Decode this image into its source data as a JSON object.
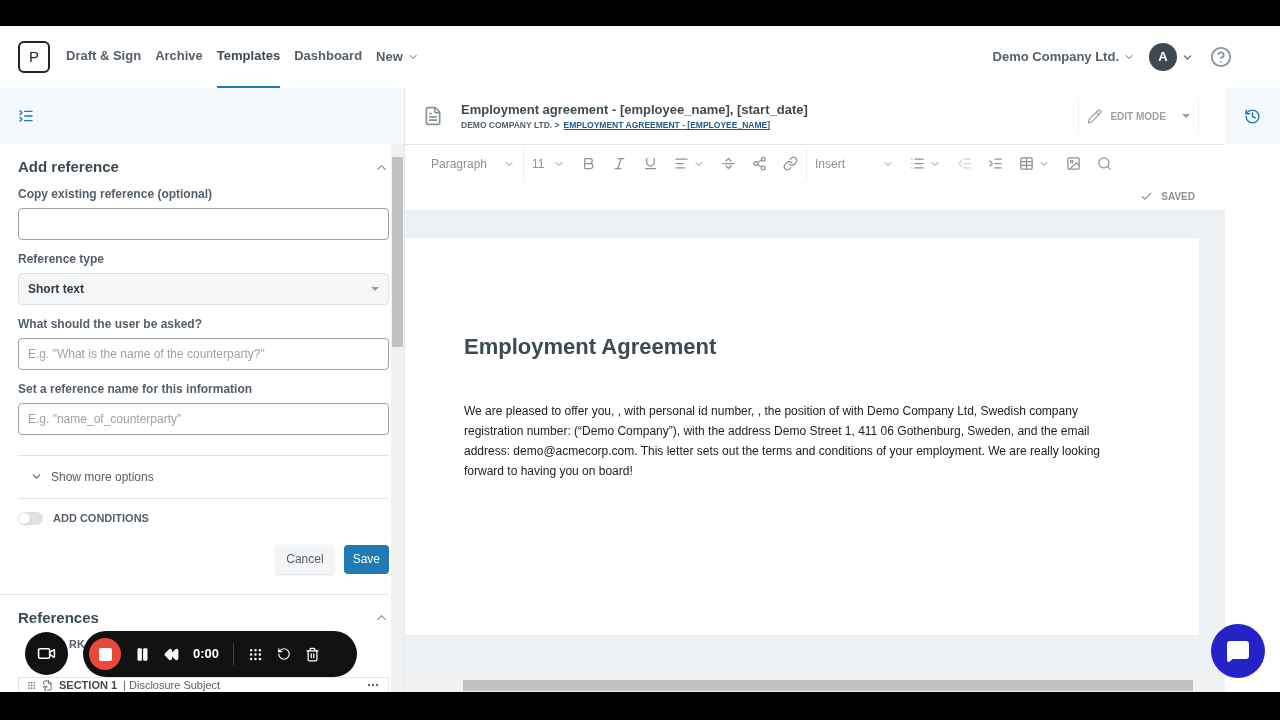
{
  "nav": {
    "logo": "P",
    "items": [
      {
        "label": "Draft & Sign",
        "selected": false
      },
      {
        "label": "Archive",
        "selected": false
      },
      {
        "label": "Templates",
        "selected": true
      },
      {
        "label": "Dashboard",
        "selected": false
      }
    ],
    "new_menu": "New",
    "company": "Demo Company Ltd.",
    "avatar": "A"
  },
  "panel": {
    "title": "Add reference",
    "fields": [
      {
        "kind": "input",
        "label": "Copy existing reference (optional)"
      },
      {
        "kind": "select",
        "label": "Reference type",
        "value": "Short text"
      },
      {
        "kind": "input",
        "label": "What should the user be asked?",
        "placeholder": "E.g. \"What is the name of the counterparty?\""
      },
      {
        "kind": "input",
        "label": "Set a reference name for this information",
        "placeholder": "E.g. \"name_of_counterparty\""
      }
    ],
    "more_options": "Show more options",
    "conditions": {
      "label": "ADD CONDITIONS",
      "on": false
    },
    "cancel": "Cancel",
    "save": "Save",
    "references": {
      "title": "References",
      "toggle_label": "RK",
      "section": {
        "number": "SECTION 1",
        "title": "| Disclosure Subject"
      }
    }
  },
  "document": {
    "title": "Employment agreement - [employee_name], [start_date]",
    "breadcrumb": "DEMO COMPANY LTD. >",
    "breadcrumb_link": "EMPLOYMENT AGREEMENT - [EMPLOYEE_NAME]",
    "mode": "EDIT MODE",
    "toolbar": {
      "style": "Paragraph",
      "size": "11",
      "insert": "Insert"
    },
    "status": "SAVED",
    "heading": "Employment Agreement",
    "body": "We are pleased to offer you, , with personal id number, , the position of  with Demo Company Ltd, Swedish company registration number:  (“Demo Company”), with the address Demo Street 1, 411 06 Gothenburg, Sweden, and the email address: demo@acmecorp.com. This letter sets out the terms and conditions of your employment. We are really looking forward to having you on board!"
  },
  "recorder": {
    "time": "0:00"
  }
}
